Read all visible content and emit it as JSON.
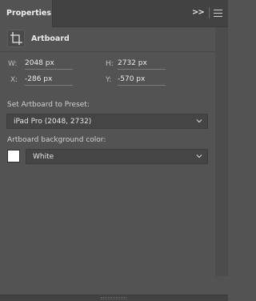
{
  "tabs": {
    "active_label": "Properties",
    "collapse_glyph": ">>",
    "icons": [
      "collapse-icon",
      "panel-menu-icon"
    ]
  },
  "header": {
    "icon": "artboard-icon",
    "title": "Artboard"
  },
  "transform": {
    "w_label": "W:",
    "w_value": "2048 px",
    "h_label": "H:",
    "h_value": "2732 px",
    "x_label": "X:",
    "x_value": "-286 px",
    "y_label": "Y:",
    "y_value": "-570 px"
  },
  "preset": {
    "label": "Set Artboard to Preset:",
    "selected": "iPad Pro (2048, 2732)"
  },
  "background": {
    "label": "Artboard background color:",
    "swatch_color": "#ffffff",
    "selected": "White"
  },
  "colors": {
    "panel_bg": "#535353",
    "tabbar_bg": "#424242",
    "dropdown_bg": "#454545"
  }
}
